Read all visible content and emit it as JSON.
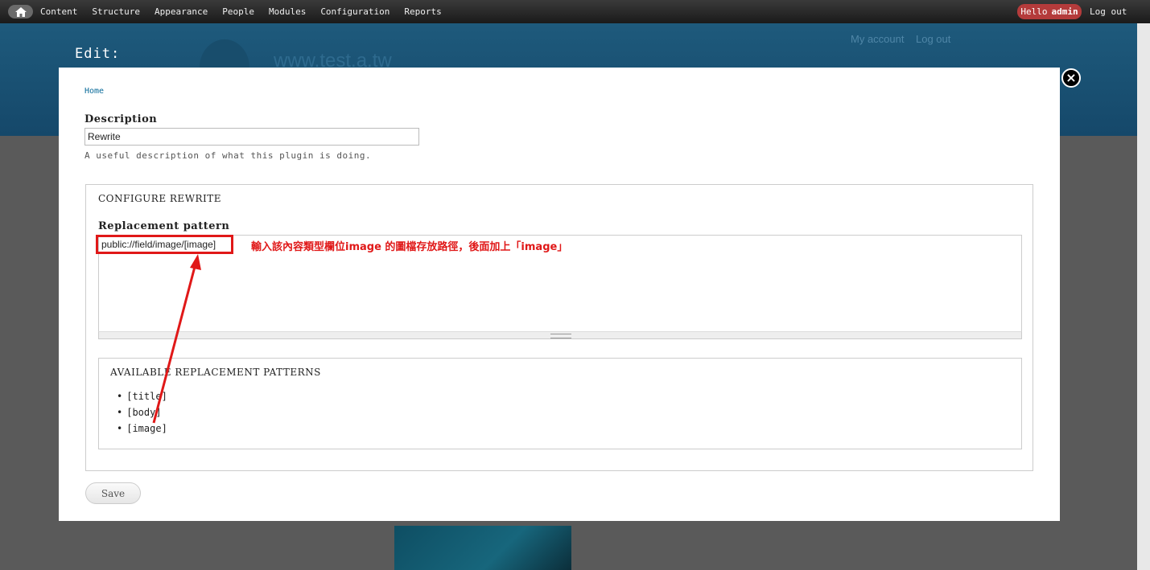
{
  "toolbar": {
    "nav": [
      "Content",
      "Structure",
      "Appearance",
      "People",
      "Modules",
      "Configuration",
      "Reports"
    ],
    "hello_prefix": "Hello",
    "hello_user": "admin",
    "logout": "Log out"
  },
  "header": {
    "edit_title": "Edit:",
    "site_name": "www.test.a.tw",
    "my_account": "My account",
    "log_out": "Log out"
  },
  "modal": {
    "breadcrumb": "Home",
    "description_label": "Description",
    "description_value": "Rewrite",
    "description_help": "A useful description of what this plugin is doing.",
    "fieldset_legend": "CONFIGURE REWRITE",
    "replacement_label": "Replacement pattern",
    "replacement_value": "public://field/image/[image]",
    "annotation": "輸入該內容類型欄位image 的圖檔存放路徑，後面加上「image」",
    "available_legend": "AVAILABLE REPLACEMENT PATTERNS",
    "patterns": [
      "[title]",
      "[body]",
      "[image]"
    ],
    "save_label": "Save"
  },
  "colors": {
    "annotation_red": "#e01818",
    "header_blue": "#1e5a7c",
    "hello_badge": "#b43b3b"
  }
}
